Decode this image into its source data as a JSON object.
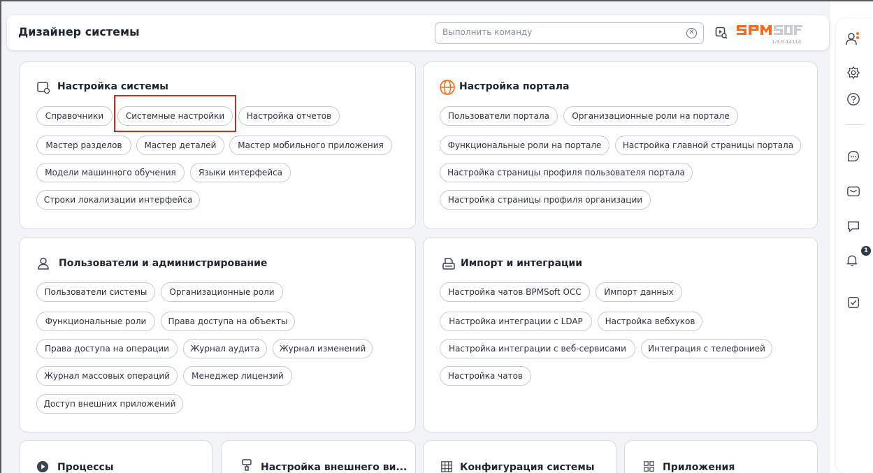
{
  "header": {
    "title": "Дизайнер системы",
    "command_placeholder": "Выполнить команду",
    "version": "1.9.0.14114"
  },
  "brand": {
    "accent": "#ff6a1a",
    "logo_gray": "#c8cdd4"
  },
  "cards": {
    "system_settings": {
      "title": "Настройка системы",
      "icon": "system-settings-icon",
      "items": [
        "Справочники",
        "Системные настройки",
        "Настройка отчетов",
        "Мастер разделов",
        "Мастер деталей",
        "Мастер мобильного приложения",
        "Модели машинного обучения",
        "Языки интерфейса",
        "Строки локализации интерфейса"
      ]
    },
    "portal_settings": {
      "title": "Настройка портала",
      "icon": "globe-icon",
      "items": [
        "Пользователи портала",
        "Организационные роли на портале",
        "Функциональные роли на портале",
        "Настройка главной страницы портала",
        "Настройка страницы профиля пользователя портала",
        "Настройка страницы профиля организации"
      ]
    },
    "users_admin": {
      "title": "Пользователи и администрирование",
      "icon": "user-icon",
      "items": [
        "Пользователи системы",
        "Организационные роли",
        "Функциональные роли",
        "Права доступа на объекты",
        "Права доступа на операции",
        "Журнал аудита",
        "Журнал изменений",
        "Журнал массовых операций",
        "Менеджер лицензий",
        "Доступ внешних приложений"
      ]
    },
    "import_integration": {
      "title": "Импорт и интеграции",
      "icon": "import-icon",
      "items": [
        "Настройка чатов BPMSoft OCC",
        "Импорт данных",
        "Настройка интеграции с LDAP",
        "Настройка вебхуков",
        "Настройка интеграции с веб-сервисами",
        "Интеграция с телефонией",
        "Настройка чатов"
      ]
    },
    "processes": {
      "title": "Процессы",
      "icon": "play-circle-icon"
    },
    "external_view": {
      "title": "Настройка внешнего ви...",
      "icon": "brush-icon"
    },
    "configuration": {
      "title": "Конфигурация системы",
      "icon": "grid-icon"
    },
    "applications": {
      "title": "Приложения",
      "icon": "apps-icon"
    }
  },
  "rail": {
    "icons": [
      "user-profile-icon",
      "gear-icon",
      "help-icon",
      "chat-icon",
      "mail-icon",
      "message-icon",
      "bell-icon",
      "task-icon"
    ],
    "notification_count": "1"
  }
}
